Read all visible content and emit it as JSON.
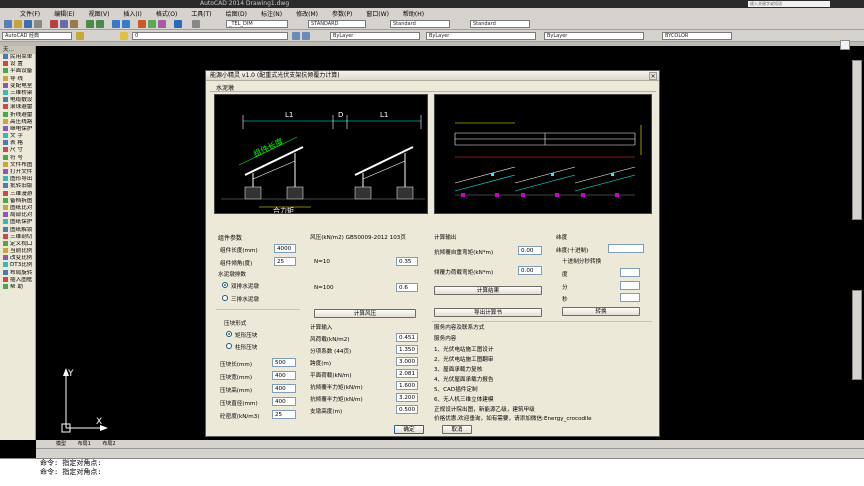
{
  "app": {
    "title": "AutoCAD 2014  Drawing1.dwg",
    "search_placeholder": "键入关键字或短语"
  },
  "menu": [
    "文件(F)",
    "编辑(E)",
    "视图(V)",
    "插入(I)",
    "格式(O)",
    "工具(T)",
    "绘图(D)",
    "标注(N)",
    "修改(M)",
    "参数(P)",
    "窗口(W)",
    "帮助(H)"
  ],
  "toolbar": {
    "workspace": "AutoCAD 经典",
    "layer": "0",
    "dimstyle": "_TEL_DIM",
    "textstyle": "STANDARD",
    "tablestyle": "Standard",
    "mleaderstyle": "Standard",
    "color": "ByLayer",
    "linetype": "ByLayer",
    "lineweight": "ByLayer",
    "plotstyle": "BYCOLOR"
  },
  "left_panel": {
    "header": "天...",
    "items": [
      "民用菜单",
      "设 置",
      "平面设备",
      "导 线",
      "变配电室",
      "三维桥架",
      "电缆敷设",
      "滚球避雷",
      "折线避雷",
      "高压线路",
      "继电保护",
      "文 字",
      "表 格",
      "尺 寸",
      "符 号",
      "文件布图",
      "打开文件",
      "图形导出",
      "批转旧版",
      "三维漫游",
      "备档拆图",
      "图纸比对",
      "局部比对",
      "图纸保护",
      "图纸解锁",
      "三维剖切",
      "定义视口",
      "当前比例",
      "改变比例",
      "DT3比例",
      "布局旋转",
      "插入图框",
      "帮 助"
    ]
  },
  "dialog": {
    "title": "能源小精灵 v1.0 (配重式光伏支架抗倾覆力计算)",
    "tab": "水泥墩",
    "left_canvas_labels": {
      "l1a": "L1",
      "d": "D",
      "l1b": "L1",
      "module": "组件长度",
      "force": "合力矩"
    },
    "section_component": "组件参数",
    "component_length_label": "组件长度(mm)",
    "component_length_value": "4000",
    "component_angle_label": "组件倾角(度)",
    "component_angle_value": "25",
    "section_arrangement": "水泥墩排数",
    "arrangement_options": [
      "双排水泥墩",
      "三排水泥墩"
    ],
    "section_pier": "压块形式",
    "pier_options": [
      "矩形压块",
      "柱形压块"
    ],
    "pier_fields": [
      {
        "label": "压块长(mm)",
        "value": "500"
      },
      {
        "label": "压块宽(mm)",
        "value": "400"
      },
      {
        "label": "压块高(mm)",
        "value": "400"
      },
      {
        "label": "压块直径(mm)",
        "value": "400"
      },
      {
        "label": "砼密度(kN/m3)",
        "value": "25"
      }
    ],
    "wind_header": "风压(kN/m2) GB50009-2012 103页",
    "wind_n10_label": "N=10",
    "wind_n10_value": "0.35",
    "wind_n100_label": "N=100",
    "wind_n100_value": "0.6",
    "calc_wind_button": "计算风压",
    "section_calc_input": "计算输入",
    "calc_fields": [
      {
        "label": "风荷载(kN/m2)",
        "value": "0.451"
      },
      {
        "label": "分项系数 (44页)",
        "value": "1.350"
      },
      {
        "label": "跨度(m)",
        "value": "3.000"
      },
      {
        "label": "平面荷载(kN/m)",
        "value": "2.081"
      },
      {
        "label": "抗倾覆半力矩(kN/m)",
        "value": "1.600"
      },
      {
        "label": "抗倾覆半力矩(kN/m)",
        "value": "3.200"
      },
      {
        "label": "支墩高度(m)",
        "value": "0.500"
      }
    ],
    "section_output": "计算输出",
    "out_resist_label": "抗倾覆自重弯矩(kN*m)",
    "out_resist_value": "0.00",
    "out_wind_label": "倾覆力荷载弯矩(kN*m)",
    "out_wind_value": "0.00",
    "calc_result_button": "计算结果",
    "export_button": "导出计算书",
    "section_latitude": "纬度",
    "latitude_decimal_label": "纬度(十进制)",
    "latitude_convert_label": "十进制分秒转换",
    "deg_label": "度",
    "min_label": "分",
    "sec_label": "秒",
    "convert_button": "转换",
    "service_header": "服务内容及联系方式",
    "service_title": "服务内容",
    "service_items": [
      "1、光伏电站施工图设计",
      "2、光伏电站施工图翻审",
      "3、屋面承载力复核",
      "4、光伏屋面承载力报告",
      "5、CAD插件定制",
      "6、无人机三维立体建模"
    ],
    "service_contact1": "正规设计院出图，新能源乙级，建筑甲级",
    "service_contact2": "价格优惠,欢迎垂询，如有需要，请添加微信:Energy_crocodile",
    "ok_button": "确定",
    "cancel_button": "取消",
    "close_glyph": "×"
  },
  "tabs": [
    "模型",
    "布局1",
    "布局2"
  ],
  "command_lines": [
    "命令: 指定对角点:",
    "命令: 指定对角点:"
  ],
  "ucs": {
    "x": "X",
    "y": "Y"
  }
}
